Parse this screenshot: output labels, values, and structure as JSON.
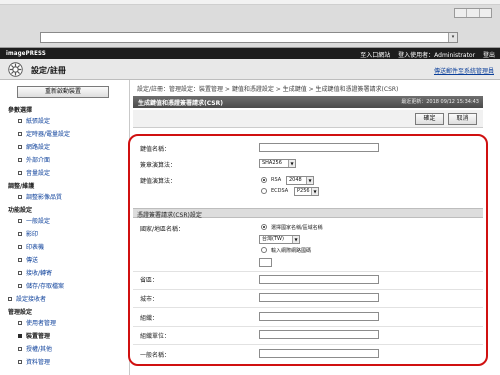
{
  "browser": {
    "address_url": "",
    "dropdown_glyph": "▾"
  },
  "topbar": {
    "brand": "imagePRESS",
    "portal_link": "至入口網站",
    "login_label": "登入使用者：",
    "user": "Administrator",
    "logout": "登出"
  },
  "header": {
    "title": "設定/註冊",
    "mail_admin": "傳送郵件至系統管理員"
  },
  "sidebar": {
    "restart_button": "重新啟動裝置",
    "sections": [
      {
        "label": "參數選擇",
        "items": [
          "紙張設定",
          "定時器/電量設定",
          "網路設定",
          "外部介面",
          "音量設定"
        ]
      },
      {
        "label": "調整/維護",
        "items": [
          "調整影像品質"
        ]
      },
      {
        "label": "功能設定",
        "items": [
          "一般設定",
          "影印",
          "印表機",
          "傳送",
          "接收/轉寄",
          "儲存/存取檔案"
        ]
      }
    ],
    "receiver_settings": "設定接收者",
    "management": {
      "label": "管理設定",
      "items": [
        "使用者管理",
        "裝置管理",
        "授權/其他",
        "資料管理"
      ],
      "selected_index": 1
    }
  },
  "main": {
    "breadcrumb": "設定/註冊：管理設定：裝置管理 > 鍵值和憑證設定 > 生成鍵值 > 生成鍵值和憑證簽署請求(CSR)",
    "section_title": "生成鍵值和憑證簽署請求(CSR)",
    "last_update": "最近更新：2018 09/12 15:34:43",
    "ok_button": "確定",
    "cancel_button": "取消",
    "form": {
      "key_name_label": "鍵值名稱：",
      "key_name_value": "",
      "signature_algo_label": "簽章演算法：",
      "signature_algo_value": "SHA256",
      "key_algo_label": "鍵值演算法：",
      "rsa_label": "RSA",
      "rsa_value": "2048",
      "ecdsa_label": "ECDSA",
      "ecdsa_value": "P256",
      "selected_key_algo": "RSA"
    },
    "csr": {
      "header": "憑證簽署請求(CSR)設定",
      "country_label": "國家/地區名稱：",
      "country_option_select": "選擇國家名稱/區域名稱",
      "country_value": "台灣(TW)",
      "country_option_internet": "輸入網際網路國碼",
      "country_code_value": "",
      "selected_country_mode": "select",
      "state_label": "省區：",
      "city_label": "城市：",
      "org_label": "組織：",
      "org_unit_label": "組織單位：",
      "common_name_label": "一般名稱："
    }
  },
  "colors": {
    "highlight_border": "#d01010",
    "link": "#0b3f9a",
    "topbar": "#1d1d1d"
  }
}
